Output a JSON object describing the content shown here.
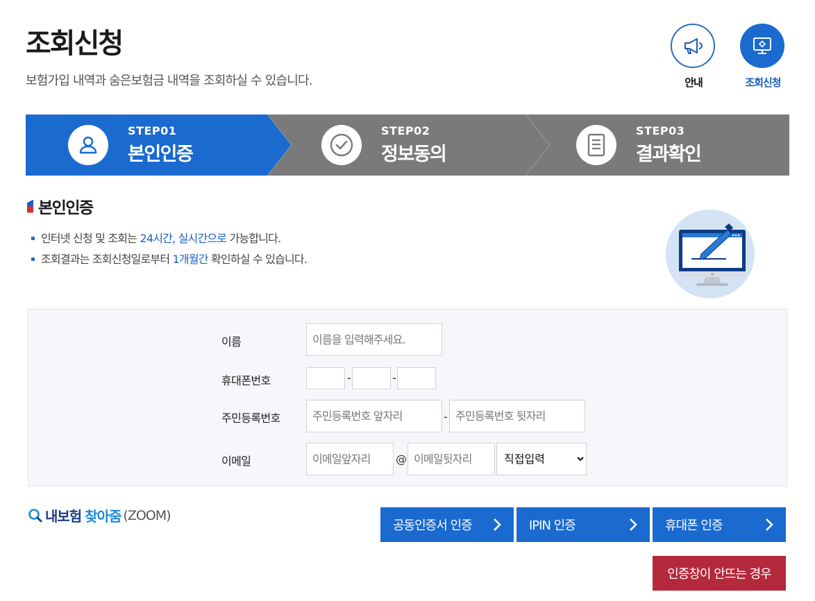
{
  "header": {
    "title": "조회신청",
    "description": "보험가입 내역과 숨은보험금 내역을 조회하실 수 있습니다."
  },
  "top_icons": [
    {
      "label": "안내",
      "icon": "megaphone-icon"
    },
    {
      "label": "조회신청",
      "icon": "monitor-settings-icon",
      "active": true
    }
  ],
  "steps": [
    {
      "num": "STEP01",
      "name": "본인인증",
      "icon": "user-icon",
      "active": true
    },
    {
      "num": "STEP02",
      "name": "정보동의",
      "icon": "check-circle-icon"
    },
    {
      "num": "STEP03",
      "name": "결과확인",
      "icon": "document-icon"
    }
  ],
  "section": {
    "title": "본인인증",
    "notes": [
      {
        "pre": "인터넷 신청 및 조회는 ",
        "hl": "24시간, 실시간으로",
        "post": " 가능합니다."
      },
      {
        "pre": "조회결과는 조회신청일로부터 ",
        "hl": "1개월간",
        "post": " 확인하실 수 있습니다."
      }
    ]
  },
  "form": {
    "name_label": "이름",
    "name_placeholder": "이름을 입력해주세요.",
    "phone_label": "휴대폰번호",
    "phone_sep": "-",
    "rrn_label": "주민등록번호",
    "rrn_front_placeholder": "주민등록번호 앞자리",
    "rrn_back_placeholder": "주민등록번호 뒷자리",
    "email_label": "이메일",
    "email_front_placeholder": "이메일앞자리",
    "email_at": "@",
    "email_back_placeholder": "이메일뒷자리",
    "email_domain_selected": "직접입력"
  },
  "zoom_logo": {
    "part1": "내보험",
    "part2": "찾아줌",
    "part3": "(ZOOM)"
  },
  "buttons": {
    "cert": "공동인증서 인증",
    "ipin": "IPIN 인증",
    "phone": "휴대폰 인증",
    "popup_help": "인증창이 안뜨는 경우"
  },
  "colors": {
    "primary": "#1a6ad0",
    "step_inactive": "#7a7a7a",
    "danger": "#b5293d",
    "highlight_text": "#1a5fc4"
  }
}
